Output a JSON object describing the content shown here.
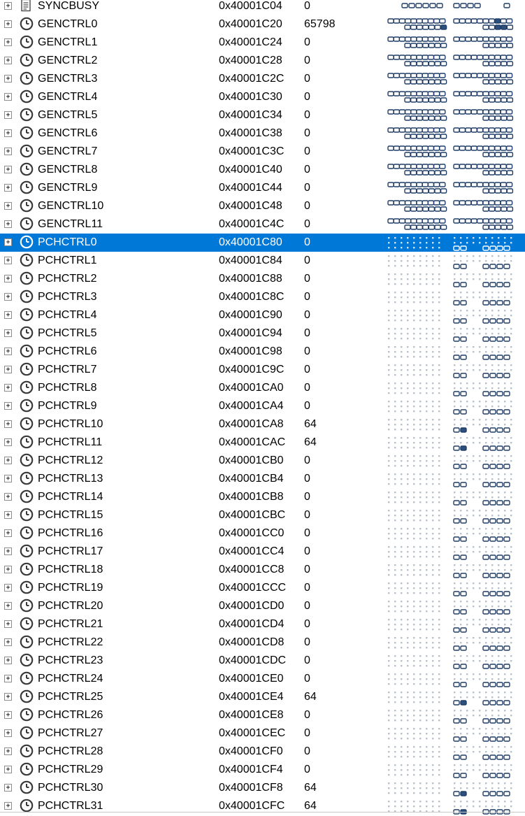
{
  "registers": [
    {
      "name": "SYNCBUSY",
      "address": "0x40001C04",
      "value": "0",
      "icon": "register-icon",
      "bits": "partial"
    },
    {
      "name": "GENCTRL0",
      "address": "0x40001C20",
      "value": "65798",
      "icon": "clock-icon",
      "bits": "gen-set"
    },
    {
      "name": "GENCTRL1",
      "address": "0x40001C24",
      "value": "0",
      "icon": "clock-icon",
      "bits": "gen"
    },
    {
      "name": "GENCTRL2",
      "address": "0x40001C28",
      "value": "0",
      "icon": "clock-icon",
      "bits": "gen"
    },
    {
      "name": "GENCTRL3",
      "address": "0x40001C2C",
      "value": "0",
      "icon": "clock-icon",
      "bits": "gen"
    },
    {
      "name": "GENCTRL4",
      "address": "0x40001C30",
      "value": "0",
      "icon": "clock-icon",
      "bits": "gen"
    },
    {
      "name": "GENCTRL5",
      "address": "0x40001C34",
      "value": "0",
      "icon": "clock-icon",
      "bits": "gen"
    },
    {
      "name": "GENCTRL6",
      "address": "0x40001C38",
      "value": "0",
      "icon": "clock-icon",
      "bits": "gen"
    },
    {
      "name": "GENCTRL7",
      "address": "0x40001C3C",
      "value": "0",
      "icon": "clock-icon",
      "bits": "gen"
    },
    {
      "name": "GENCTRL8",
      "address": "0x40001C40",
      "value": "0",
      "icon": "clock-icon",
      "bits": "gen"
    },
    {
      "name": "GENCTRL9",
      "address": "0x40001C44",
      "value": "0",
      "icon": "clock-icon",
      "bits": "gen"
    },
    {
      "name": "GENCTRL10",
      "address": "0x40001C48",
      "value": "0",
      "icon": "clock-icon",
      "bits": "gen"
    },
    {
      "name": "GENCTRL11",
      "address": "0x40001C4C",
      "value": "0",
      "icon": "clock-icon",
      "bits": "gen"
    },
    {
      "name": "PCHCTRL0",
      "address": "0x40001C80",
      "value": "0",
      "icon": "clock-icon",
      "bits": "pch",
      "selected": true
    },
    {
      "name": "PCHCTRL1",
      "address": "0x40001C84",
      "value": "0",
      "icon": "clock-icon",
      "bits": "pch"
    },
    {
      "name": "PCHCTRL2",
      "address": "0x40001C88",
      "value": "0",
      "icon": "clock-icon",
      "bits": "pch"
    },
    {
      "name": "PCHCTRL3",
      "address": "0x40001C8C",
      "value": "0",
      "icon": "clock-icon",
      "bits": "pch"
    },
    {
      "name": "PCHCTRL4",
      "address": "0x40001C90",
      "value": "0",
      "icon": "clock-icon",
      "bits": "pch"
    },
    {
      "name": "PCHCTRL5",
      "address": "0x40001C94",
      "value": "0",
      "icon": "clock-icon",
      "bits": "pch"
    },
    {
      "name": "PCHCTRL6",
      "address": "0x40001C98",
      "value": "0",
      "icon": "clock-icon",
      "bits": "pch"
    },
    {
      "name": "PCHCTRL7",
      "address": "0x40001C9C",
      "value": "0",
      "icon": "clock-icon",
      "bits": "pch"
    },
    {
      "name": "PCHCTRL8",
      "address": "0x40001CA0",
      "value": "0",
      "icon": "clock-icon",
      "bits": "pch"
    },
    {
      "name": "PCHCTRL9",
      "address": "0x40001CA4",
      "value": "0",
      "icon": "clock-icon",
      "bits": "pch"
    },
    {
      "name": "PCHCTRL10",
      "address": "0x40001CA8",
      "value": "64",
      "icon": "clock-icon",
      "bits": "pch-set"
    },
    {
      "name": "PCHCTRL11",
      "address": "0x40001CAC",
      "value": "64",
      "icon": "clock-icon",
      "bits": "pch-set"
    },
    {
      "name": "PCHCTRL12",
      "address": "0x40001CB0",
      "value": "0",
      "icon": "clock-icon",
      "bits": "pch"
    },
    {
      "name": "PCHCTRL13",
      "address": "0x40001CB4",
      "value": "0",
      "icon": "clock-icon",
      "bits": "pch"
    },
    {
      "name": "PCHCTRL14",
      "address": "0x40001CB8",
      "value": "0",
      "icon": "clock-icon",
      "bits": "pch"
    },
    {
      "name": "PCHCTRL15",
      "address": "0x40001CBC",
      "value": "0",
      "icon": "clock-icon",
      "bits": "pch"
    },
    {
      "name": "PCHCTRL16",
      "address": "0x40001CC0",
      "value": "0",
      "icon": "clock-icon",
      "bits": "pch"
    },
    {
      "name": "PCHCTRL17",
      "address": "0x40001CC4",
      "value": "0",
      "icon": "clock-icon",
      "bits": "pch"
    },
    {
      "name": "PCHCTRL18",
      "address": "0x40001CC8",
      "value": "0",
      "icon": "clock-icon",
      "bits": "pch"
    },
    {
      "name": "PCHCTRL19",
      "address": "0x40001CCC",
      "value": "0",
      "icon": "clock-icon",
      "bits": "pch"
    },
    {
      "name": "PCHCTRL20",
      "address": "0x40001CD0",
      "value": "0",
      "icon": "clock-icon",
      "bits": "pch"
    },
    {
      "name": "PCHCTRL21",
      "address": "0x40001CD4",
      "value": "0",
      "icon": "clock-icon",
      "bits": "pch"
    },
    {
      "name": "PCHCTRL22",
      "address": "0x40001CD8",
      "value": "0",
      "icon": "clock-icon",
      "bits": "pch"
    },
    {
      "name": "PCHCTRL23",
      "address": "0x40001CDC",
      "value": "0",
      "icon": "clock-icon",
      "bits": "pch"
    },
    {
      "name": "PCHCTRL24",
      "address": "0x40001CE0",
      "value": "0",
      "icon": "clock-icon",
      "bits": "pch"
    },
    {
      "name": "PCHCTRL25",
      "address": "0x40001CE4",
      "value": "64",
      "icon": "clock-icon",
      "bits": "pch-set"
    },
    {
      "name": "PCHCTRL26",
      "address": "0x40001CE8",
      "value": "0",
      "icon": "clock-icon",
      "bits": "pch"
    },
    {
      "name": "PCHCTRL27",
      "address": "0x40001CEC",
      "value": "0",
      "icon": "clock-icon",
      "bits": "pch"
    },
    {
      "name": "PCHCTRL28",
      "address": "0x40001CF0",
      "value": "0",
      "icon": "clock-icon",
      "bits": "pch"
    },
    {
      "name": "PCHCTRL29",
      "address": "0x40001CF4",
      "value": "0",
      "icon": "clock-icon",
      "bits": "pch"
    },
    {
      "name": "PCHCTRL30",
      "address": "0x40001CF8",
      "value": "64",
      "icon": "clock-icon",
      "bits": "pch-set"
    },
    {
      "name": "PCHCTRL31",
      "address": "0x40001CFC",
      "value": "64",
      "icon": "clock-icon",
      "bits": "pch-set"
    }
  ],
  "colors": {
    "selection": "#0078d7",
    "bit_set": "#2d4f7c",
    "bit_outline": "#1f3d66",
    "bit_reserved": "#b8c0cc",
    "expander_border": "#8c8c8c"
  }
}
